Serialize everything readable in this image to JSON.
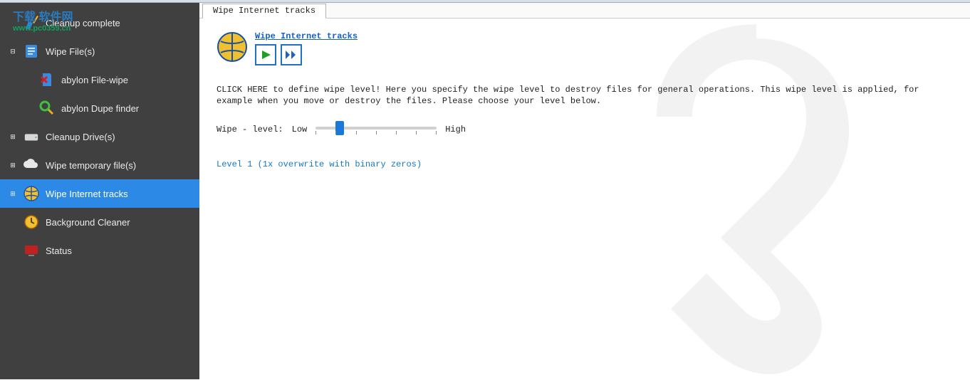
{
  "sidebar": {
    "items": [
      {
        "label": "Cleanup complete",
        "expander": ""
      },
      {
        "label": "Wipe File(s)",
        "expander": "⊟"
      },
      {
        "label": "abylon File-wipe",
        "expander": ""
      },
      {
        "label": "abylon Dupe finder",
        "expander": ""
      },
      {
        "label": "Cleanup Drive(s)",
        "expander": "⊞"
      },
      {
        "label": "Wipe temporary file(s)",
        "expander": "⊞"
      },
      {
        "label": "Wipe Internet tracks",
        "expander": "⊞"
      },
      {
        "label": "Background Cleaner",
        "expander": ""
      },
      {
        "label": "Status",
        "expander": ""
      }
    ]
  },
  "tab": {
    "label": "Wipe Internet tracks"
  },
  "main": {
    "heading_link": "Wipe Internet tracks",
    "description": "CLICK HERE to define wipe  level! Here you specify the wipe level to destroy files for general operations. This wipe level is applied, for example when you move or destroy the files. Please choose your level below.",
    "wipe_label": "Wipe - level:",
    "low": "Low",
    "high": "High",
    "level_desc": "Level 1 (1x overwrite with binary zeros)"
  },
  "watermark": {
    "line1": "下载 软件网",
    "line2": "www.pc0359.cn"
  }
}
